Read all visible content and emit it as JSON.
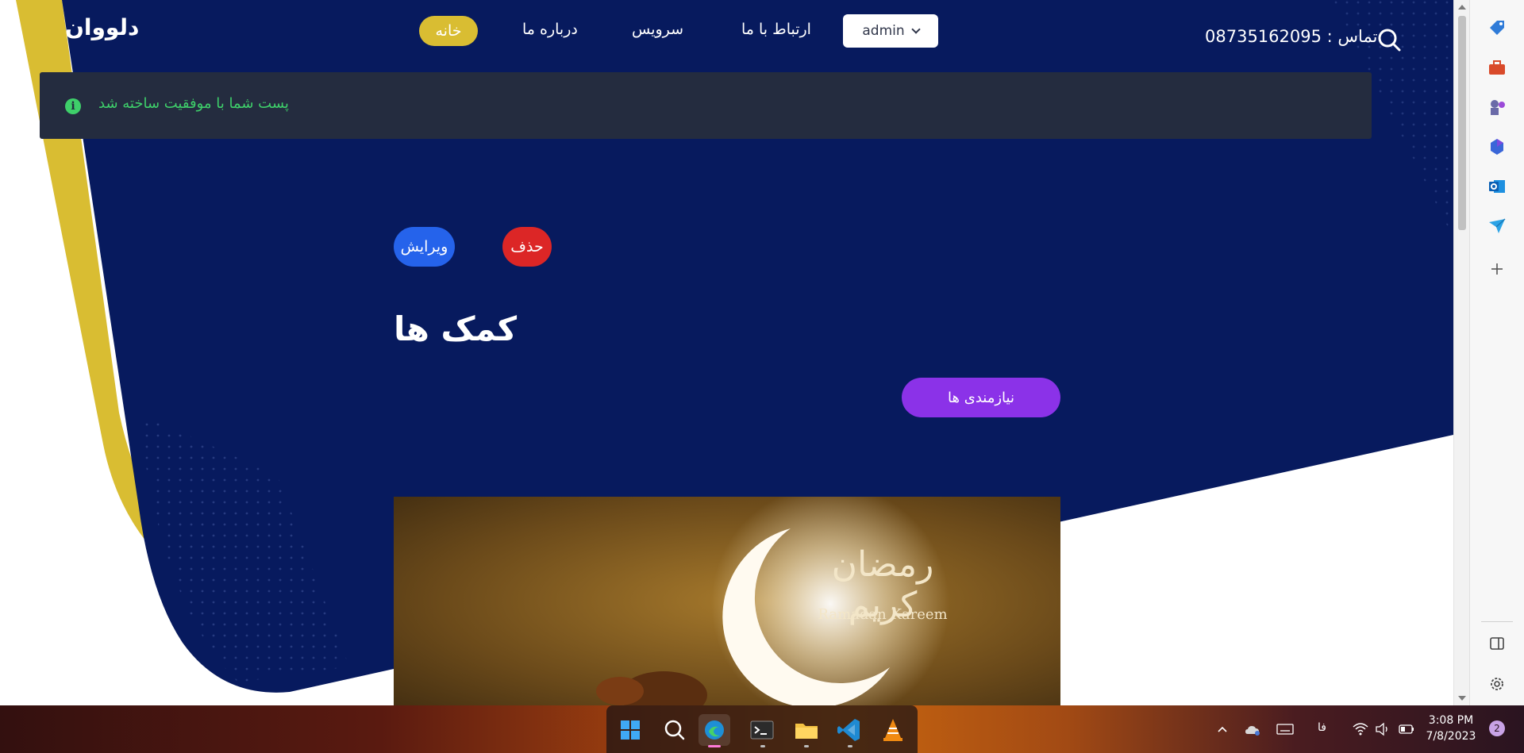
{
  "site": {
    "logo": "دلووان",
    "nav": {
      "home": "خانه",
      "about": "درباره ما",
      "services": "سرویس",
      "contact": "ارتباط با ما",
      "user_menu": "admin"
    },
    "contact_text": "تماس : 08735162095"
  },
  "alert": {
    "message": "پست شما با موفقیت ساخته شد"
  },
  "post": {
    "edit_label": "ویرایش",
    "delete_label": "حذف",
    "title": "کمک ها",
    "category_label": "نیازمندی ها",
    "image_caption_arabic": "رمضان كريم",
    "image_caption_latin": "Ramadan Kareem"
  },
  "colors": {
    "hero_navy": "#071a5e",
    "accent_yellow": "#d9bd32",
    "edit_blue": "#2563eb",
    "delete_red": "#dc2626",
    "category_purple": "#8b32e8",
    "alert_bg": "#242c3f",
    "alert_green": "#3ecf6a"
  },
  "edge_sidebar": {
    "icons": [
      "tag-icon",
      "toolbox-icon",
      "chess-icon",
      "copilot-icon",
      "outlook-icon",
      "send-icon",
      "add-icon",
      "split-view-icon",
      "settings-icon"
    ]
  },
  "taskbar": {
    "apps": [
      "windows-start-icon",
      "search-icon",
      "edge-icon",
      "terminal-icon",
      "file-explorer-icon",
      "vscode-icon",
      "vlc-icon"
    ],
    "language": "فا",
    "time": "3:08 PM",
    "date": "7/8/2023",
    "notification_count": "2"
  }
}
